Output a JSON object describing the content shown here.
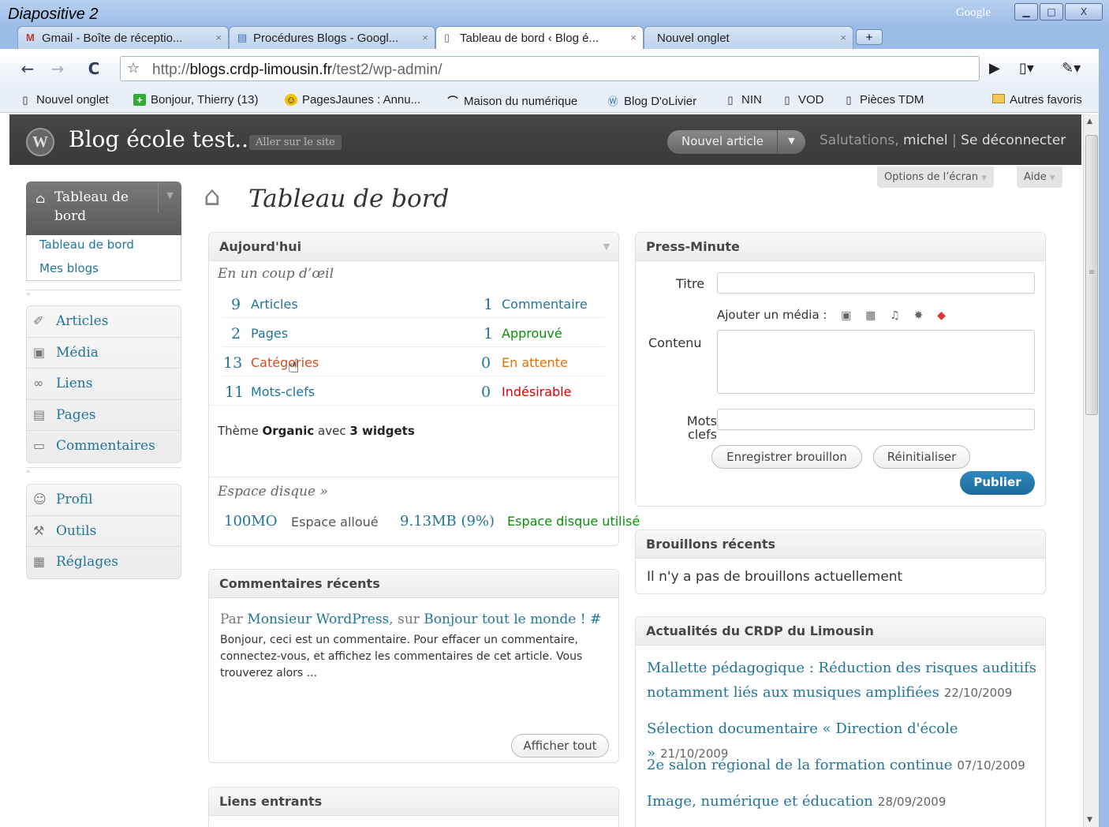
{
  "window": {
    "slide_label": "Diapositive 2",
    "google_label": "Google",
    "min_btn": "▁",
    "max_btn": "□",
    "close_btn": "X"
  },
  "tabs": [
    {
      "icon": "gmail-icon",
      "glyph": "M",
      "label": "Gmail - Boîte de réceptio...",
      "close": "×",
      "active": false
    },
    {
      "icon": "google-docs-icon",
      "glyph": "▤",
      "label": "Procédures Blogs - Googl...",
      "close": "×",
      "active": false
    },
    {
      "icon": "page-icon",
      "glyph": "▯",
      "label": "Tableau de bord ‹ Blog é...",
      "close": "×",
      "active": true
    },
    {
      "icon": "page-icon",
      "glyph": "",
      "label": "Nouvel onglet",
      "close": "×",
      "active": false
    }
  ],
  "toolbar": {
    "back": "←",
    "forward": "→",
    "reload": "C",
    "star": "☆",
    "url_prefix": "http://",
    "url_host": "blogs.crdp-limousin.fr",
    "url_path": "/test2/wp-admin/",
    "play": "▶",
    "page_menu": "▯▾",
    "wrench_menu": "✎▾"
  },
  "bookmarks": [
    {
      "icon": "page-icon",
      "glyph": "▯",
      "label": "Nouvel onglet"
    },
    {
      "icon": "plus-green-icon",
      "glyph": "+",
      "label": "Bonjour, Thierry (13)"
    },
    {
      "icon": "pagesjaunes-icon",
      "glyph": "☺",
      "label": "PagesJaunes : Annu..."
    },
    {
      "icon": "maison-numerique-icon",
      "glyph": "⌒",
      "label": "Maison du numérique"
    },
    {
      "icon": "wordpress-icon",
      "glyph": "Ⓦ",
      "label": "Blog D'oLivier"
    },
    {
      "icon": "page-icon",
      "glyph": "▯",
      "label": "NIN"
    },
    {
      "icon": "page-icon",
      "glyph": "▯",
      "label": "VOD"
    },
    {
      "icon": "page-icon",
      "glyph": "▯",
      "label": "Pièces TDM"
    }
  ],
  "bookmarks_other": {
    "icon": "folder-icon",
    "glyph": "▭",
    "label": "Autres favoris"
  },
  "wp_header": {
    "logo": "W",
    "site_title": "Blog école test...",
    "visit_site": "Aller sur le site",
    "new_post": "Nouvel article",
    "new_post_arrow": "▼",
    "greeting": "Salutations, ",
    "user": "michel",
    "separator": " | ",
    "logout": "Se déconnecter"
  },
  "screen_options": {
    "label": "Options de l’écran",
    "help": "Aide",
    "arrow": "▼"
  },
  "menu": {
    "dashboard_top": "Tableau de bord",
    "dashboard_toggle": "▼",
    "sub_items": [
      "Tableau de bord",
      "Mes blogs"
    ],
    "collapse": "«",
    "group1": [
      {
        "icon": "pin-icon",
        "glyph": "✐",
        "label": "Articles"
      },
      {
        "icon": "media-icon",
        "glyph": "▣",
        "label": "Média"
      },
      {
        "icon": "link-icon",
        "glyph": "∞",
        "label": "Liens"
      },
      {
        "icon": "pages-icon",
        "glyph": "▤",
        "label": "Pages"
      },
      {
        "icon": "comments-icon",
        "glyph": "▭",
        "label": "Commentaires"
      }
    ],
    "group2": [
      {
        "icon": "users-icon",
        "glyph": "☺",
        "label": "Profil"
      },
      {
        "icon": "tools-icon",
        "glyph": "⚒",
        "label": "Outils"
      },
      {
        "icon": "settings-icon",
        "glyph": "▦",
        "label": "Réglages"
      }
    ]
  },
  "page_title": "Tableau de bord",
  "right_now": {
    "title": "Aujourd'hui",
    "toggle": "▼",
    "subtitle": "En un coup d’œil",
    "content": [
      {
        "num": "9",
        "label": "Articles"
      },
      {
        "num": "2",
        "label": "Pages"
      },
      {
        "num": "13",
        "label": "Catégories"
      },
      {
        "num": "11",
        "label": "Mots-clefs"
      }
    ],
    "discussion": [
      {
        "num": "1",
        "label": "Commentaire",
        "color": "#21759b"
      },
      {
        "num": "1",
        "label": "Approuvé",
        "color": "#089108"
      },
      {
        "num": "0",
        "label": "En attente",
        "color": "#e66f00"
      },
      {
        "num": "0",
        "label": "Indésirable",
        "color": "#d90000"
      }
    ],
    "theme_prefix": "Thème ",
    "theme_name": "Organic",
    "theme_mid": " avec ",
    "theme_widgets": "3 widgets",
    "disk_title": "Espace disque »",
    "disk_allowed_num": "100MO",
    "disk_allowed_lbl": "Espace alloué",
    "disk_used_num": "9.13MB (9%)",
    "disk_used_lbl": "Espace disque utilisé"
  },
  "recent_comments": {
    "title": "Commentaires récents",
    "by": "Par ",
    "author": "Monsieur WordPress",
    "on": ", sur ",
    "post": "Bonjour tout le monde ! #",
    "excerpt": "Bonjour, ceci est un commentaire. Pour effacer un commentaire, connectez-vous, et affichez les commentaires de cet article. Vous trouverez alors ...",
    "view_all": "Afficher tout"
  },
  "incoming_links": {
    "title": "Liens entrants"
  },
  "quick_press": {
    "title": "Press-Minute",
    "title_label": "Titre",
    "media_label": "Ajouter un média :",
    "media_icons": [
      {
        "icon": "image-icon",
        "glyph": "▣"
      },
      {
        "icon": "video-icon",
        "glyph": "▦"
      },
      {
        "icon": "audio-icon",
        "glyph": "♫"
      },
      {
        "icon": "other-media-icon",
        "glyph": "✸"
      },
      {
        "icon": "gallery-icon",
        "glyph": "◆"
      }
    ],
    "content_label": "Contenu",
    "tags_label": "Mots clefs",
    "save_draft": "Enregistrer brouillon",
    "reset": "Réinitialiser",
    "publish": "Publier"
  },
  "recent_drafts": {
    "title": "Brouillons récents",
    "empty": "Il n'y a pas de brouillons actuellement"
  },
  "crdp_news": {
    "title": "Actualités du CRDP du Limousin",
    "items": [
      {
        "text": "Mallette pédagogique : Réduction des risques auditifs notamment liés aux musiques amplifiées",
        "date": "22/10/2009"
      },
      {
        "text": "Sélection documentaire « Direction d'école »",
        "date": "21/10/2009"
      },
      {
        "text": "2e salon régional de la formation continue",
        "date": "07/10/2009"
      },
      {
        "text": "Image, numérique et éducation",
        "date": "28/09/2009"
      }
    ]
  },
  "cursor": "☝",
  "scroll": {
    "up": "▲",
    "down": "▼",
    "grip": "≡"
  }
}
